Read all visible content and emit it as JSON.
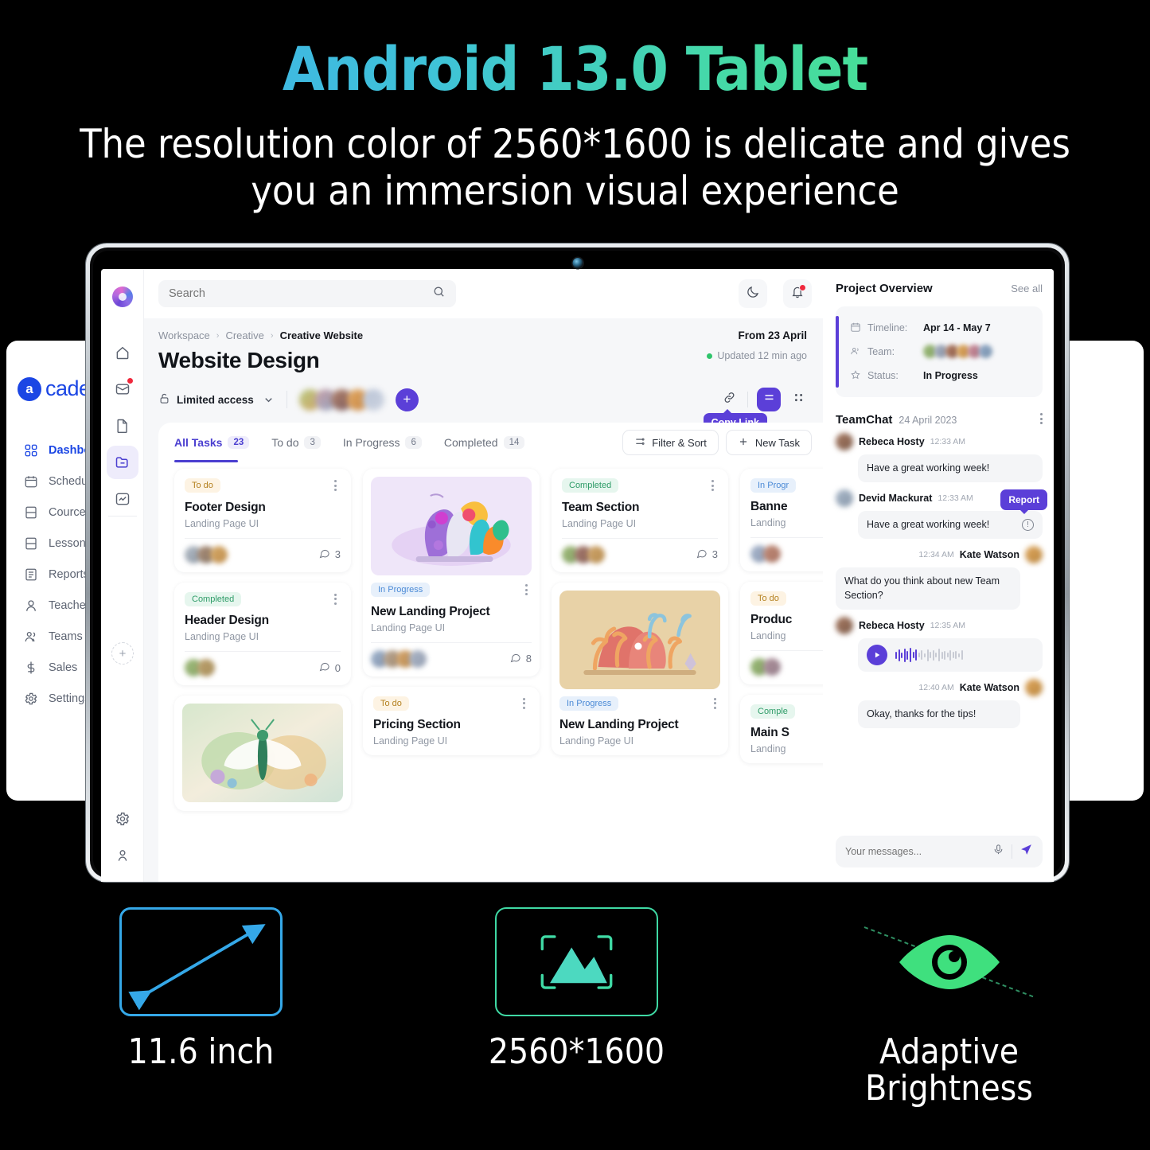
{
  "promo": {
    "headline": "Android 13.0 Tablet",
    "subhead_line1": "The resolution color of 2560*1600 is delicate and gives",
    "subhead_line2": "you an immersion visual experience",
    "accent_start": "#3fa7f0",
    "accent_end": "#4ce87c",
    "features": [
      {
        "icon": "screen-diagonal-icon",
        "label": "11.6 inch",
        "color": "#35a8e8"
      },
      {
        "icon": "image-resolution-icon",
        "label": "2560*1600",
        "color": "#3fd9a4"
      },
      {
        "icon": "eye-icon",
        "label": "Adaptive\nBrightness",
        "label_l1": "Adaptive",
        "label_l2": "Brightness",
        "color": "#3fe07e"
      }
    ]
  },
  "academix": {
    "brand_mark": "a",
    "brand_word": "cademix",
    "brand_color": "#1b46e4",
    "items": [
      {
        "label": "Dashboard",
        "icon": "grid-icon",
        "active": true
      },
      {
        "label": "Schedule",
        "icon": "calendar-icon",
        "active": false
      },
      {
        "label": "Cources",
        "icon": "book-icon",
        "active": false
      },
      {
        "label": "Lessons",
        "icon": "book-icon",
        "active": false
      },
      {
        "label": "Reports",
        "icon": "report-icon",
        "active": false
      },
      {
        "label": "Teachers",
        "icon": "user-icon",
        "active": false
      },
      {
        "label": "Teams",
        "icon": "users-icon",
        "active": false
      },
      {
        "label": "Sales",
        "icon": "dollar-icon",
        "active": false
      },
      {
        "label": "Settings",
        "icon": "gear-icon",
        "active": false
      }
    ]
  },
  "app": {
    "rail": {
      "icons": [
        "home-icon",
        "mail-icon",
        "file-icon",
        "folder-icon",
        "analytics-icon"
      ],
      "selected_index": 3,
      "mail_has_badge": true,
      "add_label": "+",
      "bottom_icons": [
        "gear-icon",
        "account-icon"
      ]
    },
    "topbar": {
      "search_placeholder": "Search",
      "search_value": "",
      "search_icon": "search-icon",
      "theme_icon": "moon-icon",
      "bell_icon": "bell-icon",
      "bell_has_badge": true
    },
    "breadcrumb": {
      "items": [
        "Workspace",
        "Creative",
        "Creative Website"
      ],
      "separator": "›"
    },
    "header": {
      "title": "Website Design",
      "from_label": "From 23 April",
      "updated_label": "Updated 12 min ago",
      "status_dot_color": "#2fc46b",
      "access_label": "Limited access",
      "access_icon": "unlock-icon",
      "chevron_icon": "chevron-down-icon",
      "add_member_label": "+"
    },
    "toolbar": {
      "link_icon": "link-icon",
      "tooltip": "Copy Link",
      "list_view_icon": "list-view-icon",
      "grid_view_icon": "grid-view-icon",
      "active_view": "list"
    },
    "tabs": [
      {
        "label": "All Tasks",
        "count": "23",
        "active": true
      },
      {
        "label": "To do",
        "count": "3",
        "active": false
      },
      {
        "label": "In Progress",
        "count": "6",
        "active": false
      },
      {
        "label": "Completed",
        "count": "14",
        "active": false
      }
    ],
    "actions": {
      "filter_label": "Filter & Sort",
      "filter_icon": "filter-icon",
      "new_task_label": "New Task",
      "new_task_icon": "plus-icon"
    },
    "columns": [
      {
        "cards": [
          {
            "status": "To do",
            "status_kind": "todo",
            "title": "Footer Design",
            "subtitle": "Landing Page UI",
            "comments": "3",
            "thumb": null
          },
          {
            "status": "Completed",
            "status_kind": "done",
            "title": "Header Design",
            "subtitle": "Landing Page UI",
            "comments": "0",
            "thumb": null
          },
          {
            "status": null,
            "status_kind": null,
            "title": null,
            "subtitle": null,
            "comments": null,
            "thumb": "butterfly"
          }
        ]
      },
      {
        "cards": [
          {
            "status": "In Progress",
            "status_kind": "prog",
            "title": "New Landing Project",
            "subtitle": "Landing Page UI",
            "comments": "8",
            "thumb": "coral-purple"
          },
          {
            "status": "To do",
            "status_kind": "todo",
            "title": "Pricing Section",
            "subtitle": "Landing Page UI",
            "comments": null,
            "thumb": null
          }
        ]
      },
      {
        "cards": [
          {
            "status": "Completed",
            "status_kind": "done",
            "title": "Team Section",
            "subtitle": "Landing Page UI",
            "comments": "3",
            "thumb": null
          },
          {
            "status": "In Progress",
            "status_kind": "prog",
            "title": "New Landing Project",
            "subtitle": "Landing Page UI",
            "comments": null,
            "thumb": "coral-orange"
          }
        ]
      },
      {
        "cards": [
          {
            "status": "In Progr",
            "status_kind": "prog",
            "title": "Banne",
            "subtitle": "Landing",
            "comments": null,
            "thumb": null
          },
          {
            "status": "To do",
            "status_kind": "todo",
            "title": "Produc",
            "subtitle": "Landing",
            "comments": null,
            "thumb": null
          },
          {
            "status": "Comple",
            "status_kind": "done",
            "title": "Main S",
            "subtitle": "Landing",
            "comments": null,
            "thumb": null
          }
        ]
      }
    ],
    "overview": {
      "title": "Project Overview",
      "see_all": "See all",
      "rows": [
        {
          "icon": "calendar-icon",
          "label": "Timeline:",
          "value": "Apr 14 - May 7",
          "kind": "text"
        },
        {
          "icon": "team-icon",
          "label": "Team:",
          "value": "",
          "kind": "avatars"
        },
        {
          "icon": "star-icon",
          "label": "Status:",
          "value": "In Progress",
          "kind": "text"
        }
      ],
      "accent": "#5b3fd8"
    },
    "chat": {
      "title": "TeamChat",
      "date": "24 April 2023",
      "menu_icon": "kebab-icon",
      "messages": [
        {
          "side": "them",
          "name": "Rebeca Hosty",
          "time": "12:33 AM",
          "type": "text",
          "text": "Have a great working week!"
        },
        {
          "side": "them",
          "name": "Devid Mackurat",
          "time": "12:33 AM",
          "type": "text",
          "text": "Have a great working week!",
          "flag": true,
          "flag_label": "Report"
        },
        {
          "side": "me",
          "name": "Kate Watson",
          "time": "12:34 AM",
          "type": "text",
          "text": "What do you think about new Team Section?"
        },
        {
          "side": "them",
          "name": "Rebeca Hosty",
          "time": "12:35 AM",
          "type": "voice"
        },
        {
          "side": "me",
          "name": "Kate Watson",
          "time": "12:40 AM",
          "type": "text",
          "text": "Okay, thanks for the tips!"
        }
      ],
      "composer": {
        "placeholder": "Your messages...",
        "mic_icon": "mic-icon",
        "send_icon": "send-icon"
      }
    }
  }
}
